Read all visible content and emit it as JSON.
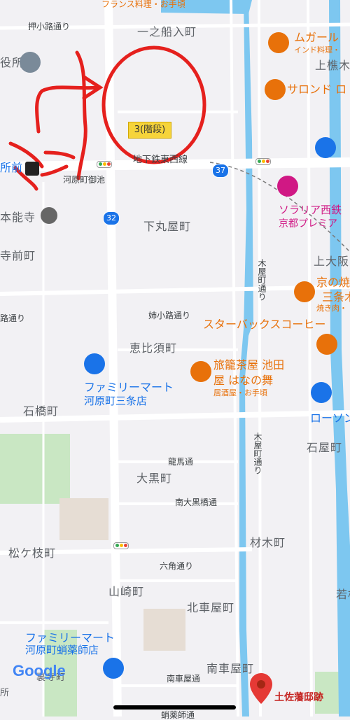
{
  "map": {
    "districts": [
      {
        "id": "ichinofunairicho",
        "text": "一之船入町"
      },
      {
        "id": "shimomaruyacho",
        "text": "下丸屋町"
      },
      {
        "id": "ebisucho",
        "text": "恵比須町"
      },
      {
        "id": "ishibashicho",
        "text": "石橋町"
      },
      {
        "id": "daikokucho",
        "text": "大黒町"
      },
      {
        "id": "matsugaecho",
        "text": "松ケ枝町"
      },
      {
        "id": "yamazakicho",
        "text": "山崎町"
      },
      {
        "id": "kitakurumayacho",
        "text": "北車屋町"
      },
      {
        "id": "minamikurumayacho",
        "text": "南車屋町"
      },
      {
        "id": "zaimokucho",
        "text": "材木町"
      },
      {
        "id": "ishiyacho",
        "text": "石屋町"
      },
      {
        "id": "teramaecho",
        "text": "寺前町"
      },
      {
        "id": "kamiosaka",
        "text": "上大阪"
      },
      {
        "id": "kamishumoku",
        "text": "上樵木"
      },
      {
        "id": "waka",
        "text": "若松"
      },
      {
        "id": "urateracho",
        "text": "裏寺町"
      },
      {
        "id": "sho",
        "text": "所"
      },
      {
        "id": "yakusho",
        "text": "役所"
      }
    ],
    "streets": [
      {
        "id": "oshikoji",
        "text": "押小路通り"
      },
      {
        "id": "anekoji",
        "text": "姉小路通り"
      },
      {
        "id": "anekoji-left",
        "text": "路通り"
      },
      {
        "id": "ryoma",
        "text": "龍馬通"
      },
      {
        "id": "minamiokurobashi",
        "text": "南大黒橋通"
      },
      {
        "id": "rokkaku",
        "text": "六角通り"
      },
      {
        "id": "minamikurumaya",
        "text": "南車屋通"
      },
      {
        "id": "kiyamachi1",
        "text": "木屋町通り"
      },
      {
        "id": "kiyamachi2",
        "text": "木屋町通り"
      },
      {
        "id": "tozai",
        "text": "地下鉄東西線"
      },
      {
        "id": "takoyakushi",
        "text": "蛸薬師通"
      }
    ],
    "pois": {
      "mugal": {
        "name": "ムガール",
        "sub": "インド料理・"
      },
      "salon": {
        "name": "サロンド ロ"
      },
      "sorraria": {
        "name": "ソラリア西鉄",
        "sub": "京都プレミア"
      },
      "kyonoyaki": {
        "name": "京の焼",
        "sub1": "三条木",
        "sub2": "焼き肉・"
      },
      "starbucks": {
        "name": "スターバックスコーヒー"
      },
      "ikedaya": {
        "name": "旅籠茶屋 池田",
        "name2": "屋 はなの舞",
        "sub": "居酒屋・お手頃"
      },
      "famima1": {
        "name": "ファミリーマート",
        "name2": "河原町三条店"
      },
      "famima2": {
        "name": "ファミリーマート",
        "name2": "河原町蛸薬師店"
      },
      "lawson": {
        "name": "ローソン"
      },
      "honnoji": {
        "name": "本能寺"
      },
      "kawaramachi": {
        "name": "河原町御池"
      },
      "french": {
        "name": "フランス料理・お手頃"
      },
      "tosa": {
        "name": "土佐藩邸跡"
      },
      "station": {
        "name": "所前"
      }
    },
    "annotation": {
      "stairs": "3(階段)"
    },
    "routes": {
      "r32": "32",
      "r37": "37"
    },
    "logo": "Google",
    "colors": {
      "river": "#7dc7f0",
      "park": "#c9e7c3",
      "road": "#ffffff",
      "accent": "#e53935"
    }
  }
}
